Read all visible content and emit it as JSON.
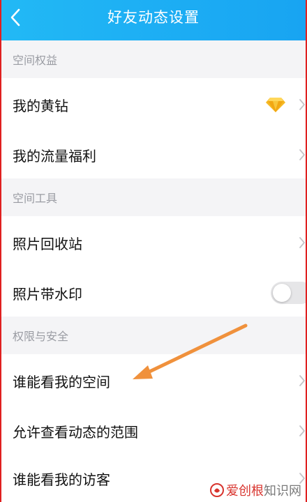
{
  "header": {
    "title": "好友动态设置",
    "back_icon": "chevron-left-icon"
  },
  "sections": [
    {
      "title": "空间权益",
      "items": [
        {
          "label": "我的黄钻",
          "icon": "diamond-icon",
          "has_chevron": true
        },
        {
          "label": "我的流量福利",
          "has_chevron": true
        }
      ]
    },
    {
      "title": "空间工具",
      "items": [
        {
          "label": "照片回收站",
          "has_chevron": true
        },
        {
          "label": "照片带水印",
          "toggle": false
        }
      ]
    },
    {
      "title": "权限与安全",
      "items": [
        {
          "label": "谁能看我的空间",
          "has_chevron": true
        },
        {
          "label": "允许查看动态的范围",
          "has_chevron": true
        },
        {
          "label": "谁能看我的访客",
          "has_chevron": true
        }
      ]
    }
  ],
  "annotation": {
    "type": "arrow",
    "color": "#f0913c",
    "points_to": "谁能看我的空间"
  },
  "watermark": {
    "brand_part": "爱创根",
    "rest_part": "知识网"
  },
  "colors": {
    "header_bg": "#1aaaf3",
    "page_bg": "#f4f4f6",
    "section_text": "#9a9ca3",
    "diamond": "#f5b823",
    "frame_border": "#e02020"
  }
}
